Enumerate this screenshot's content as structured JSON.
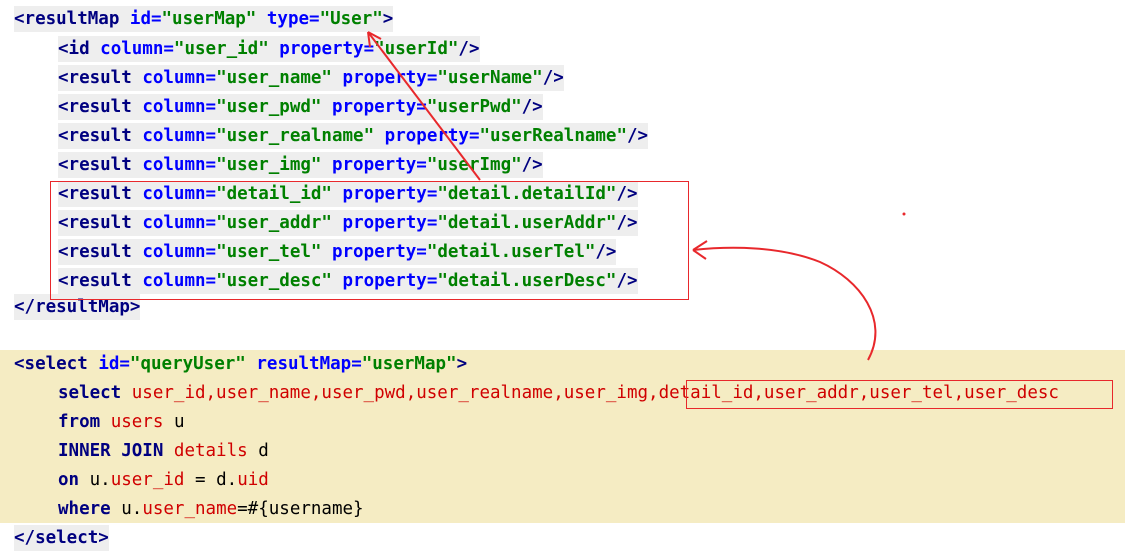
{
  "result_map": {
    "open": {
      "tag": "<resultMap",
      "id_attr": "id=",
      "id_val": "\"userMap\"",
      "type_attr": "type=",
      "type_val": "\"User\"",
      "close": ">"
    },
    "rows": [
      {
        "tag": "<id",
        "col_attr": "column=",
        "col_val": "\"user_id\"",
        "prop_attr": "property=",
        "prop_val": "\"userId\"",
        "end": "/>"
      },
      {
        "tag": "<result",
        "col_attr": "column=",
        "col_val": "\"user_name\"",
        "prop_attr": "property=",
        "prop_val": "\"userName\"",
        "end": "/>"
      },
      {
        "tag": "<result",
        "col_attr": "column=",
        "col_val": "\"user_pwd\"",
        "prop_attr": "property=",
        "prop_val": "\"userPwd\"",
        "end": "/>"
      },
      {
        "tag": "<result",
        "col_attr": "column=",
        "col_val": "\"user_realname\"",
        "prop_attr": "property=",
        "prop_val": "\"userRealname\"",
        "end": "/>"
      },
      {
        "tag": "<result",
        "col_attr": "column=",
        "col_val": "\"user_img\"",
        "prop_attr": "property=",
        "prop_val": "\"userImg\"",
        "end": "/>"
      },
      {
        "tag": "<result",
        "col_attr": "column=",
        "col_val": "\"detail_id\"",
        "prop_attr": "property=",
        "prop_val": "\"detail.detailId\"",
        "end": "/>"
      },
      {
        "tag": "<result",
        "col_attr": "column=",
        "col_val": "\"user_addr\"",
        "prop_attr": "property=",
        "prop_val": "\"detail.userAddr\"",
        "end": "/>"
      },
      {
        "tag": "<result",
        "col_attr": "column=",
        "col_val": "\"user_tel\"",
        "prop_attr": "property=",
        "prop_val": "\"detail.userTel\"",
        "end": "/>"
      },
      {
        "tag": "<result",
        "col_attr": "column=",
        "col_val": "\"user_desc\"",
        "prop_attr": "property=",
        "prop_val": "\"detail.userDesc\"",
        "end": "/>"
      }
    ],
    "close": "</resultMap>"
  },
  "select": {
    "open": {
      "tag": "<select",
      "id_attr": "id=",
      "id_val": "\"queryUser\"",
      "rm_attr": "resultMap=",
      "rm_val": "\"userMap\"",
      "close": ">"
    },
    "line1": {
      "kw": "select",
      "cols_a": "user_id,user_name,user_pwd,user_realname,user_img,",
      "cols_b": "detail_id,user_addr,user_tel,user_desc"
    },
    "line2": {
      "kw": "from",
      "table": "users",
      "alias": "u"
    },
    "line3": {
      "kw": "INNER JOIN",
      "table": "details",
      "alias": "d"
    },
    "line4": {
      "kw": "on",
      "left_prefix": "u.",
      "left_col": "user_id",
      "eq": "=",
      "right_prefix": "d.",
      "right_col": "uid"
    },
    "line5": {
      "kw": "where",
      "prefix": "u.",
      "col": "user_name",
      "rest": "=#{username}"
    },
    "close": "</select>"
  },
  "annotation_color": "#e8282c"
}
